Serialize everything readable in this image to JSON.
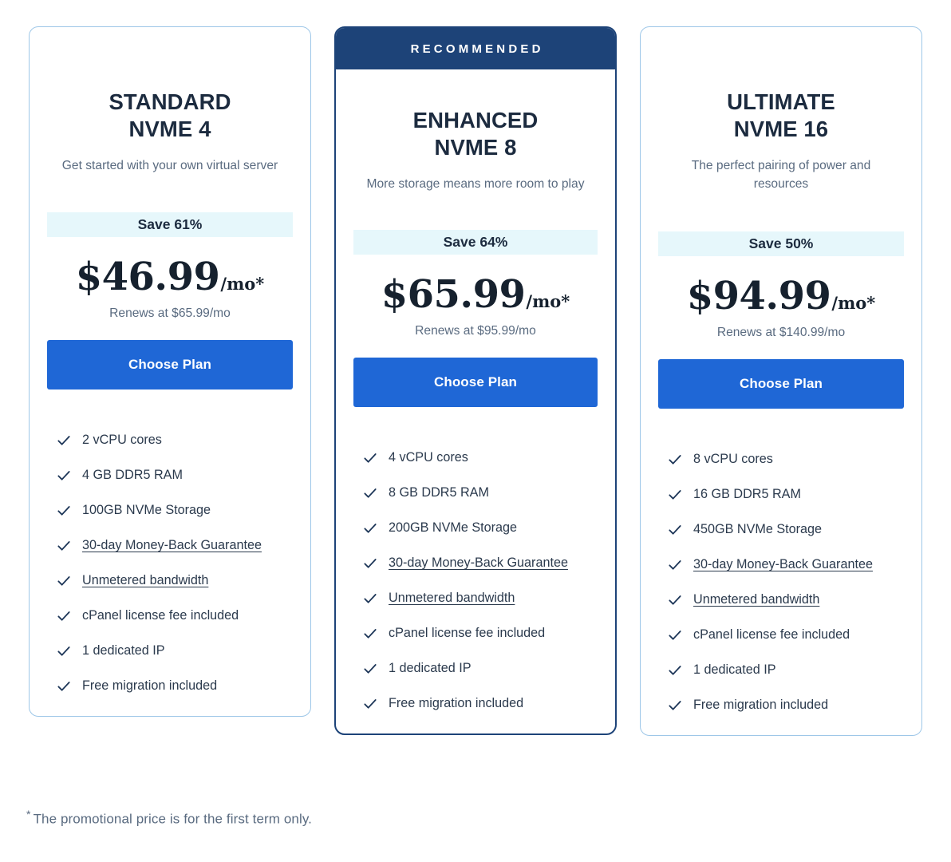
{
  "footnote": {
    "star": "*",
    "text": "The promotional price is for the first term only."
  },
  "colors": {
    "accent_button": "#1f67d6",
    "ribbon_navy": "#1d4378",
    "badge_bg": "#e6f7fb",
    "card_border": "#9ec7e8",
    "featured_border": "#1d4378",
    "heading": "#1c2b3f",
    "muted_text": "#5a6b80",
    "check_icon": "#1c3557"
  },
  "plans": [
    {
      "id": "standard-nvme-4",
      "ribbon": null,
      "title_line1": "STANDARD",
      "title_line2": "NVME 4",
      "subtitle": "Get started with your own virtual server",
      "save_label": "Save 61%",
      "price_main": "$46.99",
      "price_suffix": "/mo*",
      "renews": "Renews at $65.99/mo",
      "cta_label": "Choose Plan",
      "features": [
        {
          "text": "2 vCPU cores",
          "link": false
        },
        {
          "text": "4 GB DDR5 RAM",
          "link": false
        },
        {
          "text": "100GB NVMe Storage",
          "link": false
        },
        {
          "text": "30-day Money-Back Guarantee",
          "link": true
        },
        {
          "text": "Unmetered bandwidth",
          "link": true
        },
        {
          "text": "cPanel license fee included",
          "link": false
        },
        {
          "text": "1 dedicated IP",
          "link": false
        },
        {
          "text": "Free migration included",
          "link": false
        }
      ]
    },
    {
      "id": "enhanced-nvme-8",
      "ribbon": "RECOMMENDED",
      "title_line1": "ENHANCED",
      "title_line2": "NVME 8",
      "subtitle": "More storage means more room to play",
      "save_label": "Save 64%",
      "price_main": "$65.99",
      "price_suffix": "/mo*",
      "renews": "Renews at $95.99/mo",
      "cta_label": "Choose Plan",
      "features": [
        {
          "text": "4 vCPU cores",
          "link": false
        },
        {
          "text": "8 GB DDR5 RAM",
          "link": false
        },
        {
          "text": "200GB NVMe Storage",
          "link": false
        },
        {
          "text": "30-day Money-Back Guarantee",
          "link": true
        },
        {
          "text": "Unmetered bandwidth",
          "link": true
        },
        {
          "text": "cPanel license fee included",
          "link": false
        },
        {
          "text": "1 dedicated IP",
          "link": false
        },
        {
          "text": "Free migration included",
          "link": false
        }
      ]
    },
    {
      "id": "ultimate-nvme-16",
      "ribbon": null,
      "title_line1": "ULTIMATE",
      "title_line2": "NVME 16",
      "subtitle": "The perfect pairing of power and resources",
      "save_label": "Save 50%",
      "price_main": "$94.99",
      "price_suffix": "/mo*",
      "renews": "Renews at $140.99/mo",
      "cta_label": "Choose Plan",
      "features": [
        {
          "text": "8 vCPU cores",
          "link": false
        },
        {
          "text": "16 GB DDR5 RAM",
          "link": false
        },
        {
          "text": "450GB NVMe Storage",
          "link": false
        },
        {
          "text": "30-day Money-Back Guarantee",
          "link": true
        },
        {
          "text": "Unmetered bandwidth",
          "link": true
        },
        {
          "text": "cPanel license fee included",
          "link": false
        },
        {
          "text": "1 dedicated IP",
          "link": false
        },
        {
          "text": "Free migration included",
          "link": false
        }
      ]
    }
  ]
}
